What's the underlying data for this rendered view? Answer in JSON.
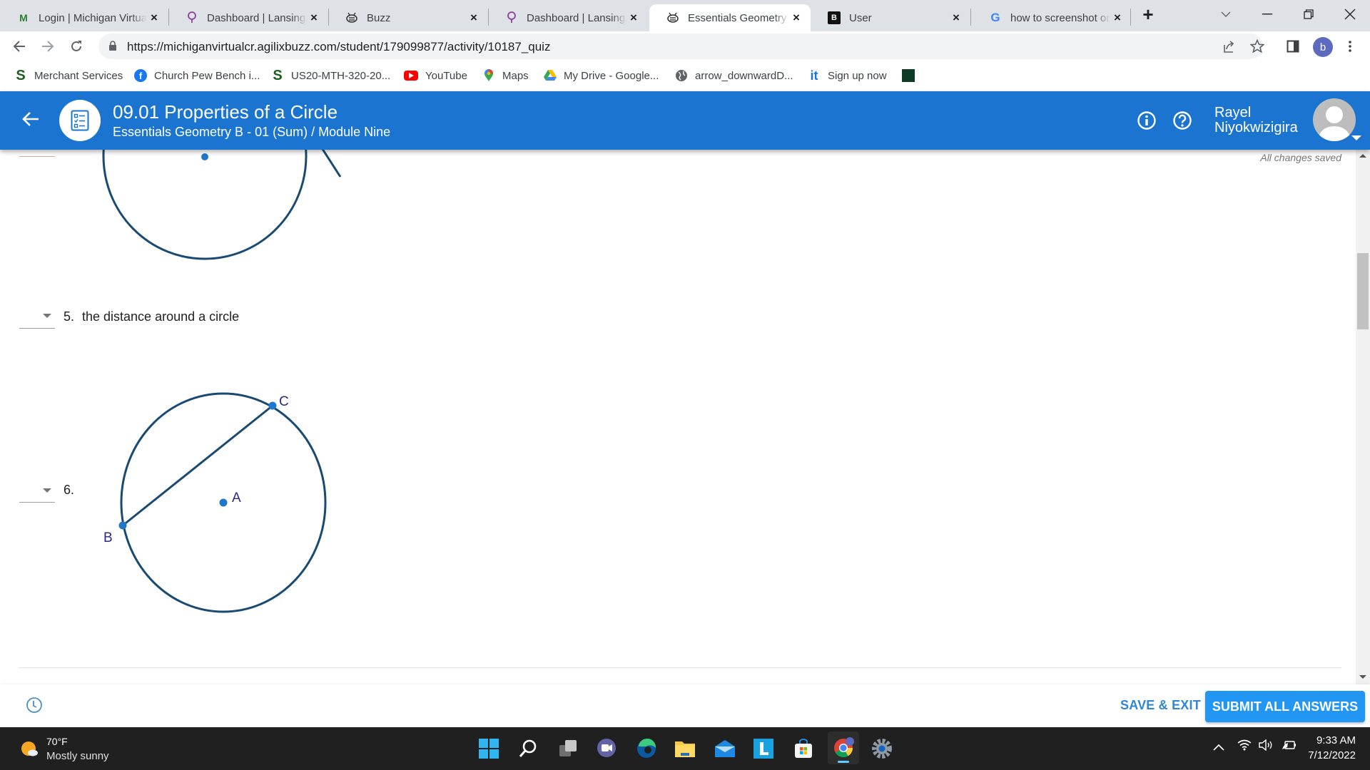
{
  "browser": {
    "tabs": [
      {
        "title": "Login | Michigan Virtual",
        "icon": "michigan-virtual-icon",
        "active": false
      },
      {
        "title": "Dashboard | Lansing Community",
        "icon": "lightbulb-icon",
        "active": false
      },
      {
        "title": "Buzz",
        "icon": "buzz-bee-icon",
        "active": false
      },
      {
        "title": "Dashboard | Lansing Community",
        "icon": "lightbulb-icon",
        "active": false
      },
      {
        "title": "Essentials Geometry B",
        "icon": "buzz-bee-icon",
        "active": true
      },
      {
        "title": "User",
        "icon": "b-logo-icon",
        "active": false
      },
      {
        "title": "how to screenshot on",
        "icon": "google-icon",
        "active": false
      }
    ],
    "new_tab_label": "+",
    "url": "https://michiganvirtualcr.agilixbuzz.com/student/179099877/activity/10187_quiz",
    "profile_initial": "b",
    "bookmarks": [
      {
        "label": "Merchant Services",
        "icon": "s-logo-icon"
      },
      {
        "label": "Church Pew Bench i...",
        "icon": "facebook-icon"
      },
      {
        "label": "US20-MTH-320-20...",
        "icon": "s-logo-icon"
      },
      {
        "label": "YouTube",
        "icon": "youtube-icon"
      },
      {
        "label": "Maps",
        "icon": "maps-pin-icon"
      },
      {
        "label": "My Drive - Google...",
        "icon": "google-drive-icon"
      },
      {
        "label": "arrow_downwardD...",
        "icon": "globe-icon"
      },
      {
        "label": "Sign up now",
        "icon": "it-logo-icon"
      },
      {
        "label": "",
        "icon": "green-app-icon"
      }
    ]
  },
  "header": {
    "title": "09.01 Properties of a Circle",
    "subtitle": "Essentials Geometry B - 01 (Sum) / Module Nine",
    "user_name_line1": "Rayel",
    "user_name_line2": "Niyokwizigira"
  },
  "content": {
    "save_status": "All changes saved",
    "questions": [
      {
        "number": "5.",
        "text": "the distance around a circle",
        "answer": ""
      },
      {
        "number": "6.",
        "text": "",
        "answer": "",
        "figure": {
          "points": [
            "A",
            "B",
            "C"
          ],
          "center": "A",
          "chord": "BC"
        }
      }
    ]
  },
  "footer": {
    "save_exit_label": "SAVE & EXIT",
    "submit_label": "SUBMIT ALL ANSWERS"
  },
  "colors": {
    "brand_blue": "#1b75d0",
    "submit_blue": "#2196f3",
    "circle_stroke": "#1a4a72",
    "point_blue": "#1f77c9"
  },
  "taskbar": {
    "temperature": "70°F",
    "weather": "Mostly sunny",
    "time": "9:33 AM",
    "date": "7/12/2022"
  }
}
